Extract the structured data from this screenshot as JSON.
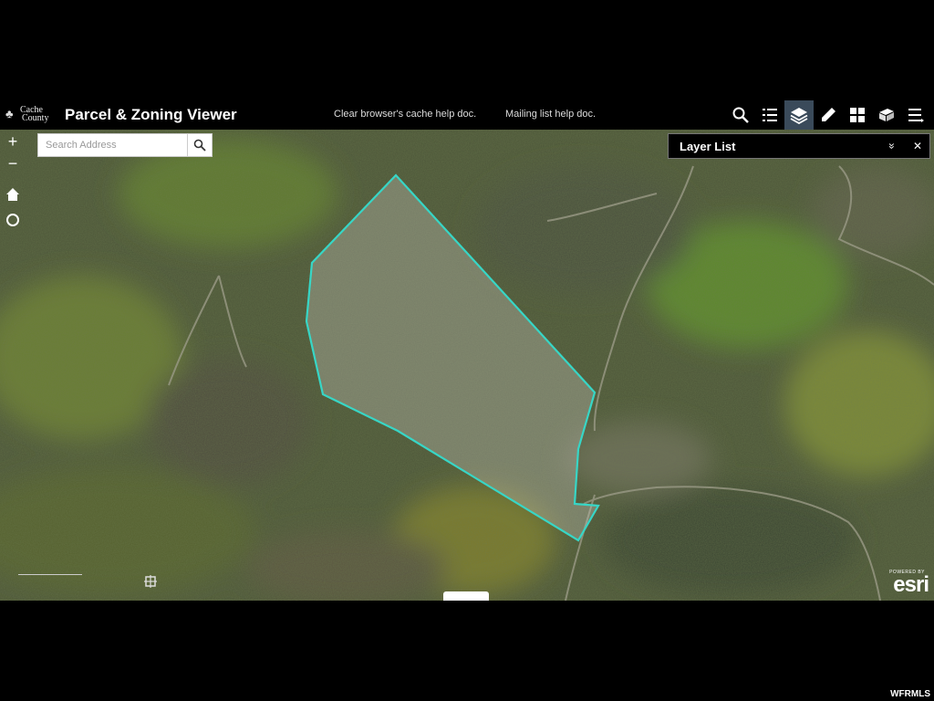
{
  "app": {
    "logo_line1": "Cache",
    "logo_line2": "County",
    "title": "Parcel & Zoning Viewer"
  },
  "header_links": [
    {
      "label": "Clear browser's cache help doc."
    },
    {
      "label": "Mailing list help doc."
    }
  ],
  "toolbar": [
    {
      "name": "search-tool-icon",
      "active": false
    },
    {
      "name": "legend-tool-icon",
      "active": false
    },
    {
      "name": "layer-list-tool-icon",
      "active": true
    },
    {
      "name": "measure-tool-icon",
      "active": false
    },
    {
      "name": "basemap-gallery-tool-icon",
      "active": false
    },
    {
      "name": "print-tool-icon",
      "active": false
    },
    {
      "name": "more-menu-icon",
      "active": false
    }
  ],
  "map": {
    "zoom_in": "+",
    "zoom_out": "−",
    "search": {
      "placeholder": "Search Address",
      "value": ""
    },
    "parcel_outline_color": "#37d6c6"
  },
  "panel": {
    "title": "Layer List",
    "collapse": "»",
    "close": "✕"
  },
  "attribution": {
    "powered_by": "POWERED BY",
    "brand": "esri"
  },
  "watermark": "WFRMLS"
}
